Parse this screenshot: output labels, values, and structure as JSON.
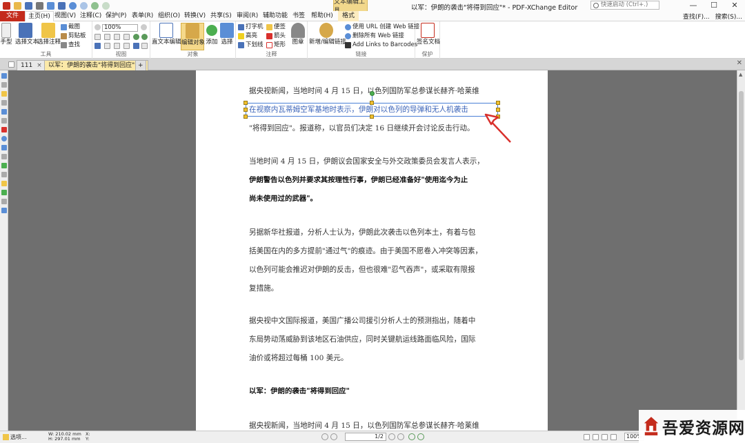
{
  "titlebar": {
    "context_group": "文本编辑工具",
    "window_title": "以军：伊朗的袭击\"将得到回应\"* - PDF-XChange Editor",
    "quick_launch_placeholder": "快速启动 (Ctrl+.)"
  },
  "tabs": [
    {
      "label": "文件"
    },
    {
      "label": "主页(H)"
    },
    {
      "label": "视图(V)"
    },
    {
      "label": "注释(C)"
    },
    {
      "label": "保护(P)"
    },
    {
      "label": "表单(R)"
    },
    {
      "label": "组织(O)"
    },
    {
      "label": "转换(V)"
    },
    {
      "label": "共享(S)"
    },
    {
      "label": "审阅(R)"
    },
    {
      "label": "辅助功能"
    },
    {
      "label": "书签"
    },
    {
      "label": "帮助(H)"
    },
    {
      "label": "格式"
    }
  ],
  "right_tools": {
    "find": "查找(F)...",
    "search": "搜索(S)..."
  },
  "ribbon": {
    "hand": "手型",
    "select_text": "选择文本",
    "select_annot": "选择注释",
    "snapshot": "截图",
    "clipboard": "剪贴板",
    "find": "查找",
    "group_tools": "工具",
    "zoom_value": "100%",
    "group_view": "视图",
    "edit_text": "直文本编辑",
    "edit_object": "编辑对象",
    "add": "添加",
    "select": "选择",
    "group_object": "对象",
    "typewriter": "打字机",
    "note": "便签",
    "highlight": "高亮",
    "arrow": "箭头",
    "underline": "下划线",
    "rectangle": "矩形",
    "stamp": "图章",
    "group_comment": "注释",
    "new_link": "新增/编辑链接",
    "use_url": "使用 URL 创建 Web 链接",
    "remove_web": "删除所有 Web 链接",
    "add_barcode": "Add Links to Barcodes",
    "group_link": "链接",
    "sign": "签名文档",
    "group_protect": "保护"
  },
  "doc_tabs": [
    {
      "label": "111"
    },
    {
      "label": "以军：伊朗的袭击\"将得到回应\""
    }
  ],
  "document": {
    "p1": [
      "据央视新闻，当地时间 4 月 15 日，以色列国防军总参谋长赫齐·哈莱维",
      "在视察内瓦蒂姆空军基地时表示，伊朗对以色列的导弹和无人机袭击",
      "\"将得到回应\"。报道称，以官员们决定 16 日继续开会讨论反击行动。"
    ],
    "p2": [
      "当地时间 4 月 15 日，伊朗议会国家安全与外交政策委员会发言人表示，"
    ],
    "p2b": [
      "伊朗警告以色列并要求其按理性行事，伊朗已经准备好\"使用迄今为止",
      "尚未使用过的武器\"。"
    ],
    "p3": [
      "另据新华社报道，分析人士认为，伊朗此次袭击以色列本土，有着与包",
      "括美国在内的多方提前\"通过气\"的痕迹。由于美国不愿卷入冲突等因素，",
      "以色列可能会推迟对伊朗的反击，但也很难\"忍气吞声\"，或采取有限报",
      "复措施。"
    ],
    "p4": [
      "据央视中文国际报道，美国广播公司援引分析人士的预测指出，随着中",
      "东局势动荡威胁到该地区石油供应，同时关键航运线路面临风险，国际",
      "油价或将超过每桶 100 美元。"
    ],
    "heading": "以军：伊朗的袭击\"将得到回应\"",
    "p5": [
      "据央视新闻，当地时间 4 月 15 日，以色列国防军总参谋长赫齐·哈莱维"
    ]
  },
  "statusbar": {
    "options": "选项...",
    "w": "W: 210.02 mm",
    "h": "H: 297.01 mm",
    "x": "X:",
    "y": "Y:",
    "page": "1/2",
    "zoom": "100%"
  },
  "watermark": "吾爱资源网",
  "colors": {
    "file_tab": "#c42b1c",
    "context": "#f2d88c",
    "selection": "#4a7fd6",
    "annotation_arrow": "#d9302c"
  }
}
